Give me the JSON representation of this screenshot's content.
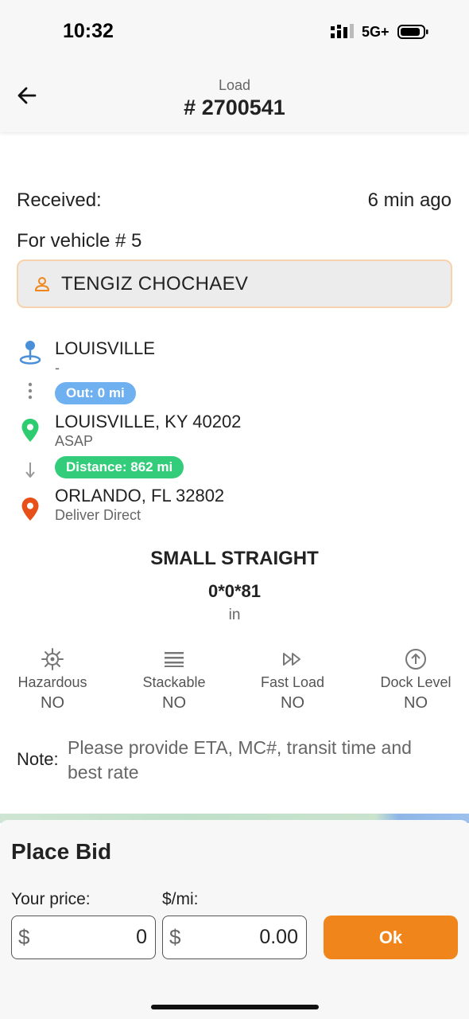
{
  "status_bar": {
    "time": "10:32",
    "network": "5G+"
  },
  "header": {
    "label": "Load",
    "number": "# 2700541"
  },
  "received": {
    "label": "Received:",
    "value": "6 min ago"
  },
  "vehicle": "For vehicle # 5",
  "driver": {
    "name": "TENGIZ CHOCHAEV",
    "icon": "person-icon"
  },
  "route": {
    "current": {
      "title": "LOUISVILLE",
      "sub": "-"
    },
    "out_pill": "Out: 0 mi",
    "pickup": {
      "title": "LOUISVILLE, KY 40202",
      "sub": "ASAP"
    },
    "distance_pill": "Distance: 862 mi",
    "delivery": {
      "title": "ORLANDO, FL 32802",
      "sub": "Deliver Direct"
    }
  },
  "truck": {
    "type": "SMALL STRAIGHT",
    "dims": "0*0*81",
    "unit": "in"
  },
  "features": [
    {
      "label": "Hazardous",
      "value": "NO",
      "icon": "hazard-icon"
    },
    {
      "label": "Stackable",
      "value": "NO",
      "icon": "stack-icon"
    },
    {
      "label": "Fast Load",
      "value": "NO",
      "icon": "fast-forward-icon"
    },
    {
      "label": "Dock Level",
      "value": "NO",
      "icon": "dock-up-icon"
    }
  ],
  "note": {
    "label": "Note:",
    "text": "Please provide ETA, MC#, transit time and best rate"
  },
  "bid": {
    "title": "Place Bid",
    "price_label": "Your price:",
    "per_mile_label": "$/mi:",
    "currency": "$",
    "price_value": "0",
    "per_mile_value": "0.00",
    "ok_label": "Ok"
  },
  "colors": {
    "accent": "#f0861b",
    "blue_pill": "#6fb0f0",
    "green_pill": "#33cc7a",
    "pickup_pin": "#2ecc71",
    "delivery_pin": "#e8501a",
    "current_pin": "#4a90d9"
  }
}
